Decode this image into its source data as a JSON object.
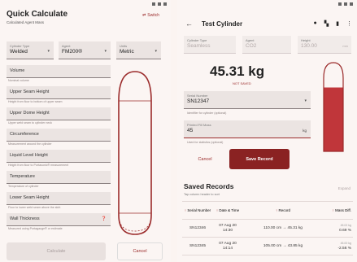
{
  "left": {
    "title": "Quick Calculate",
    "subtitle": "Calculated Agent Mass",
    "switch_label": "Switch",
    "cylinder_type": {
      "label": "Cylinder Type",
      "value": "Welded"
    },
    "agent": {
      "label": "Agent",
      "value": "FM200®"
    },
    "units": {
      "label": "Units",
      "value": "Metric"
    },
    "fields": [
      {
        "label": "Volume",
        "help": "Nominal volume"
      },
      {
        "label": "Upper Seam Height",
        "help": "Height from floor to bottom of upper seam"
      },
      {
        "label": "Upper Dome Height",
        "help": "Upper weld seam to cylinder neck"
      },
      {
        "label": "Circumference",
        "help": "Measurement around the cylinder"
      },
      {
        "label": "Liquid Level Height",
        "help": "Height from floor to Portasonic® measurement"
      },
      {
        "label": "Temperature",
        "help": "Temperature of cylinder"
      },
      {
        "label": "Lower Seam Height",
        "help": "Floor to lower weld seam above the skirt"
      },
      {
        "label": "Wall Thickness",
        "help": "Measured using Portagauge® or estimate"
      }
    ],
    "calculate_label": "Calculate",
    "cancel_label": "Cancel"
  },
  "right": {
    "title": "Test Cylinder",
    "top_fields": [
      {
        "label": "Cylinder Type",
        "value": "Seamless"
      },
      {
        "label": "Agent",
        "value": "CO2"
      },
      {
        "label": "Height",
        "value": "130.00",
        "unit": "mm"
      }
    ],
    "mass_value": "45.31 kg",
    "not_saved": "NOT SAVED",
    "fill_fraction": 0.72,
    "serial": {
      "label": "Serial Number",
      "value": "SN12347",
      "help": "Identifier for cylinder (optional)"
    },
    "printed_mass": {
      "label": "Printed Fill Mass",
      "value": "45",
      "unit": "kg",
      "help": "Used for statistics (optional)"
    },
    "cancel_label": "Cancel",
    "save_label": "Save Record",
    "saved_title": "Saved Records",
    "saved_hint": "Tap column header to sort",
    "expand_label": "Expand",
    "headers": {
      "serial": "Serial Number",
      "date": "Date & Time",
      "record": "Record",
      "mass_diff": "Mass Diff."
    },
    "rows": [
      {
        "serial": "SN12346",
        "date": "07 Aug 20",
        "time": "14:30",
        "record": "110.00 cm → 45.31 kg",
        "diff_time": "45.02 kg",
        "diff": "0.69 %"
      },
      {
        "serial": "SN12345",
        "date": "07 Aug 20",
        "time": "14:14",
        "record": "105.00 cm → 43.85 kg",
        "diff_time": "45.00 kg",
        "diff": "-2.56 %"
      }
    ]
  },
  "colors": {
    "accent": "#9b2b2b",
    "fill": "#c0363a",
    "bg": "#fbf5f3"
  }
}
